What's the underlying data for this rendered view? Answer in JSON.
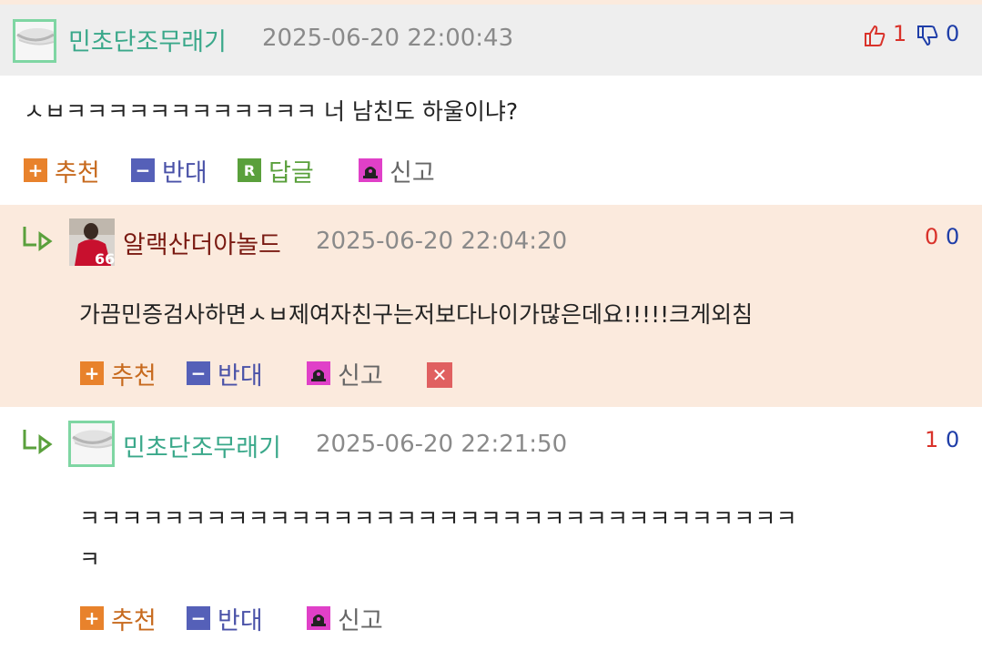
{
  "comments": [
    {
      "nickname": "민초단조무래기",
      "time": "2025-06-20 22:00:43",
      "up": "1",
      "down": "0",
      "text": "ㅅㅂㅋㅋㅋㅋㅋㅋㅋㅋㅋㅋㅋㅋ 너 남친도 하울이냐?",
      "actions": {
        "recommend": "추천",
        "oppose": "반대",
        "reply": "답글",
        "report": "신고"
      }
    },
    {
      "nickname": "알랙산더아놀드",
      "time": "2025-06-20 22:04:20",
      "up": "0",
      "down": "0",
      "text": "가끔민증검사하면ㅅㅂ제여자친구는저보다나이가많은데요!!!!!크게외침",
      "actions": {
        "recommend": "추천",
        "oppose": "반대",
        "report": "신고"
      }
    },
    {
      "nickname": "민초단조무래기",
      "time": "2025-06-20 22:21:50",
      "up": "1",
      "down": "0",
      "text_line1": "ㅋㅋㅋㅋㅋㅋㅋㅋㅋㅋㅋㅋㅋㅋㅋㅋㅋㅋㅋㅋㅋㅋㅋㅋㅋㅋㅋㅋㅋㅋㅋㅋㅋㅋ",
      "text_line2": "ㅋ",
      "actions": {
        "recommend": "추천",
        "oppose": "반대",
        "report": "신고"
      }
    }
  ],
  "icons": {
    "plus": "+",
    "minus": "−",
    "reply": "R",
    "delete": "✕",
    "avatar_red_number": "66"
  },
  "colors": {
    "header_gray": "#eeeeee",
    "reply_peach": "#fbeadd",
    "nick_green": "#3aa88a",
    "nick_brown": "#7a1a12",
    "up_red": "#d9322a",
    "down_blue": "#1f3ea8"
  }
}
